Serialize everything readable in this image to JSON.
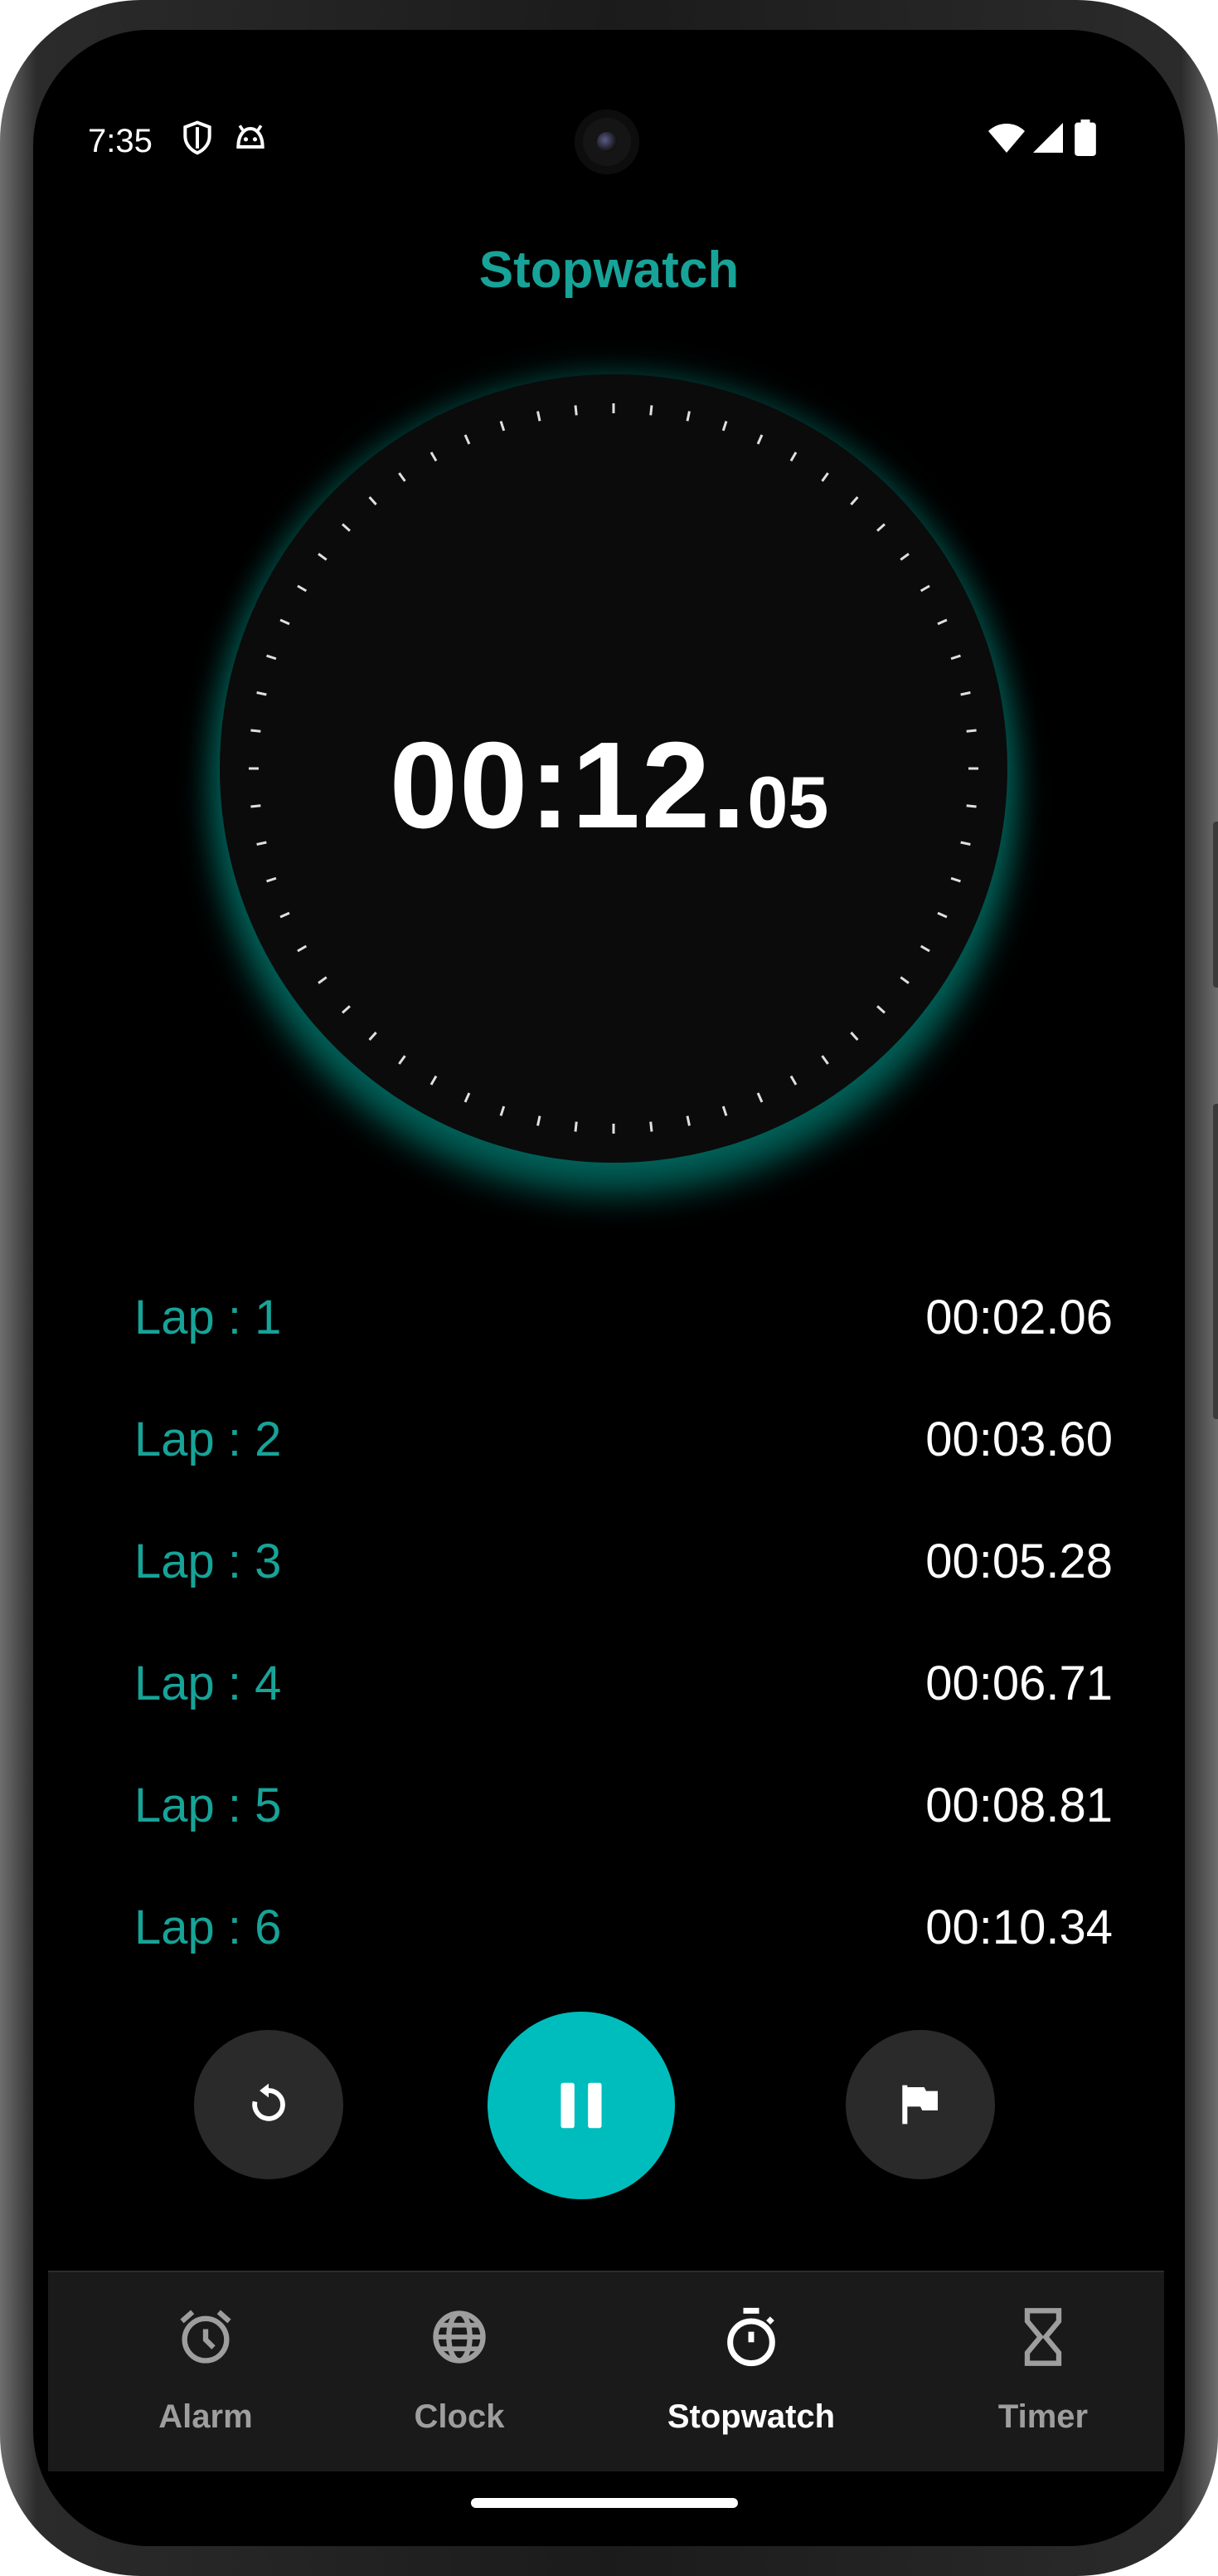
{
  "status_bar": {
    "time": "7:35",
    "left_icons": [
      "shield-icon",
      "android-face-icon"
    ],
    "right_icons": [
      "wifi-icon",
      "signal-icon",
      "battery-icon"
    ]
  },
  "title": "Stopwatch",
  "stopwatch": {
    "main": "00:12.",
    "fraction": "05"
  },
  "laps": [
    {
      "label": "Lap : 1",
      "time": "00:02.06"
    },
    {
      "label": "Lap : 2",
      "time": "00:03.60"
    },
    {
      "label": "Lap : 3",
      "time": "00:05.28"
    },
    {
      "label": "Lap : 4",
      "time": "00:06.71"
    },
    {
      "label": "Lap : 5",
      "time": "00:08.81"
    },
    {
      "label": "Lap : 6",
      "time": "00:10.34"
    }
  ],
  "controls": {
    "reset_icon": "reset-icon",
    "pause_icon": "pause-icon",
    "lap_icon": "flag-icon"
  },
  "nav": [
    {
      "label": "Alarm",
      "icon": "alarm-icon",
      "active": false
    },
    {
      "label": "Clock",
      "icon": "globe-icon",
      "active": false
    },
    {
      "label": "Stopwatch",
      "icon": "stopwatch-icon",
      "active": true
    },
    {
      "label": "Timer",
      "icon": "hourglass-icon",
      "active": false
    }
  ],
  "colors": {
    "accent": "#17a398",
    "primary_button": "#00bdbd",
    "background": "#000000",
    "nav_background": "#1a1a1a"
  }
}
